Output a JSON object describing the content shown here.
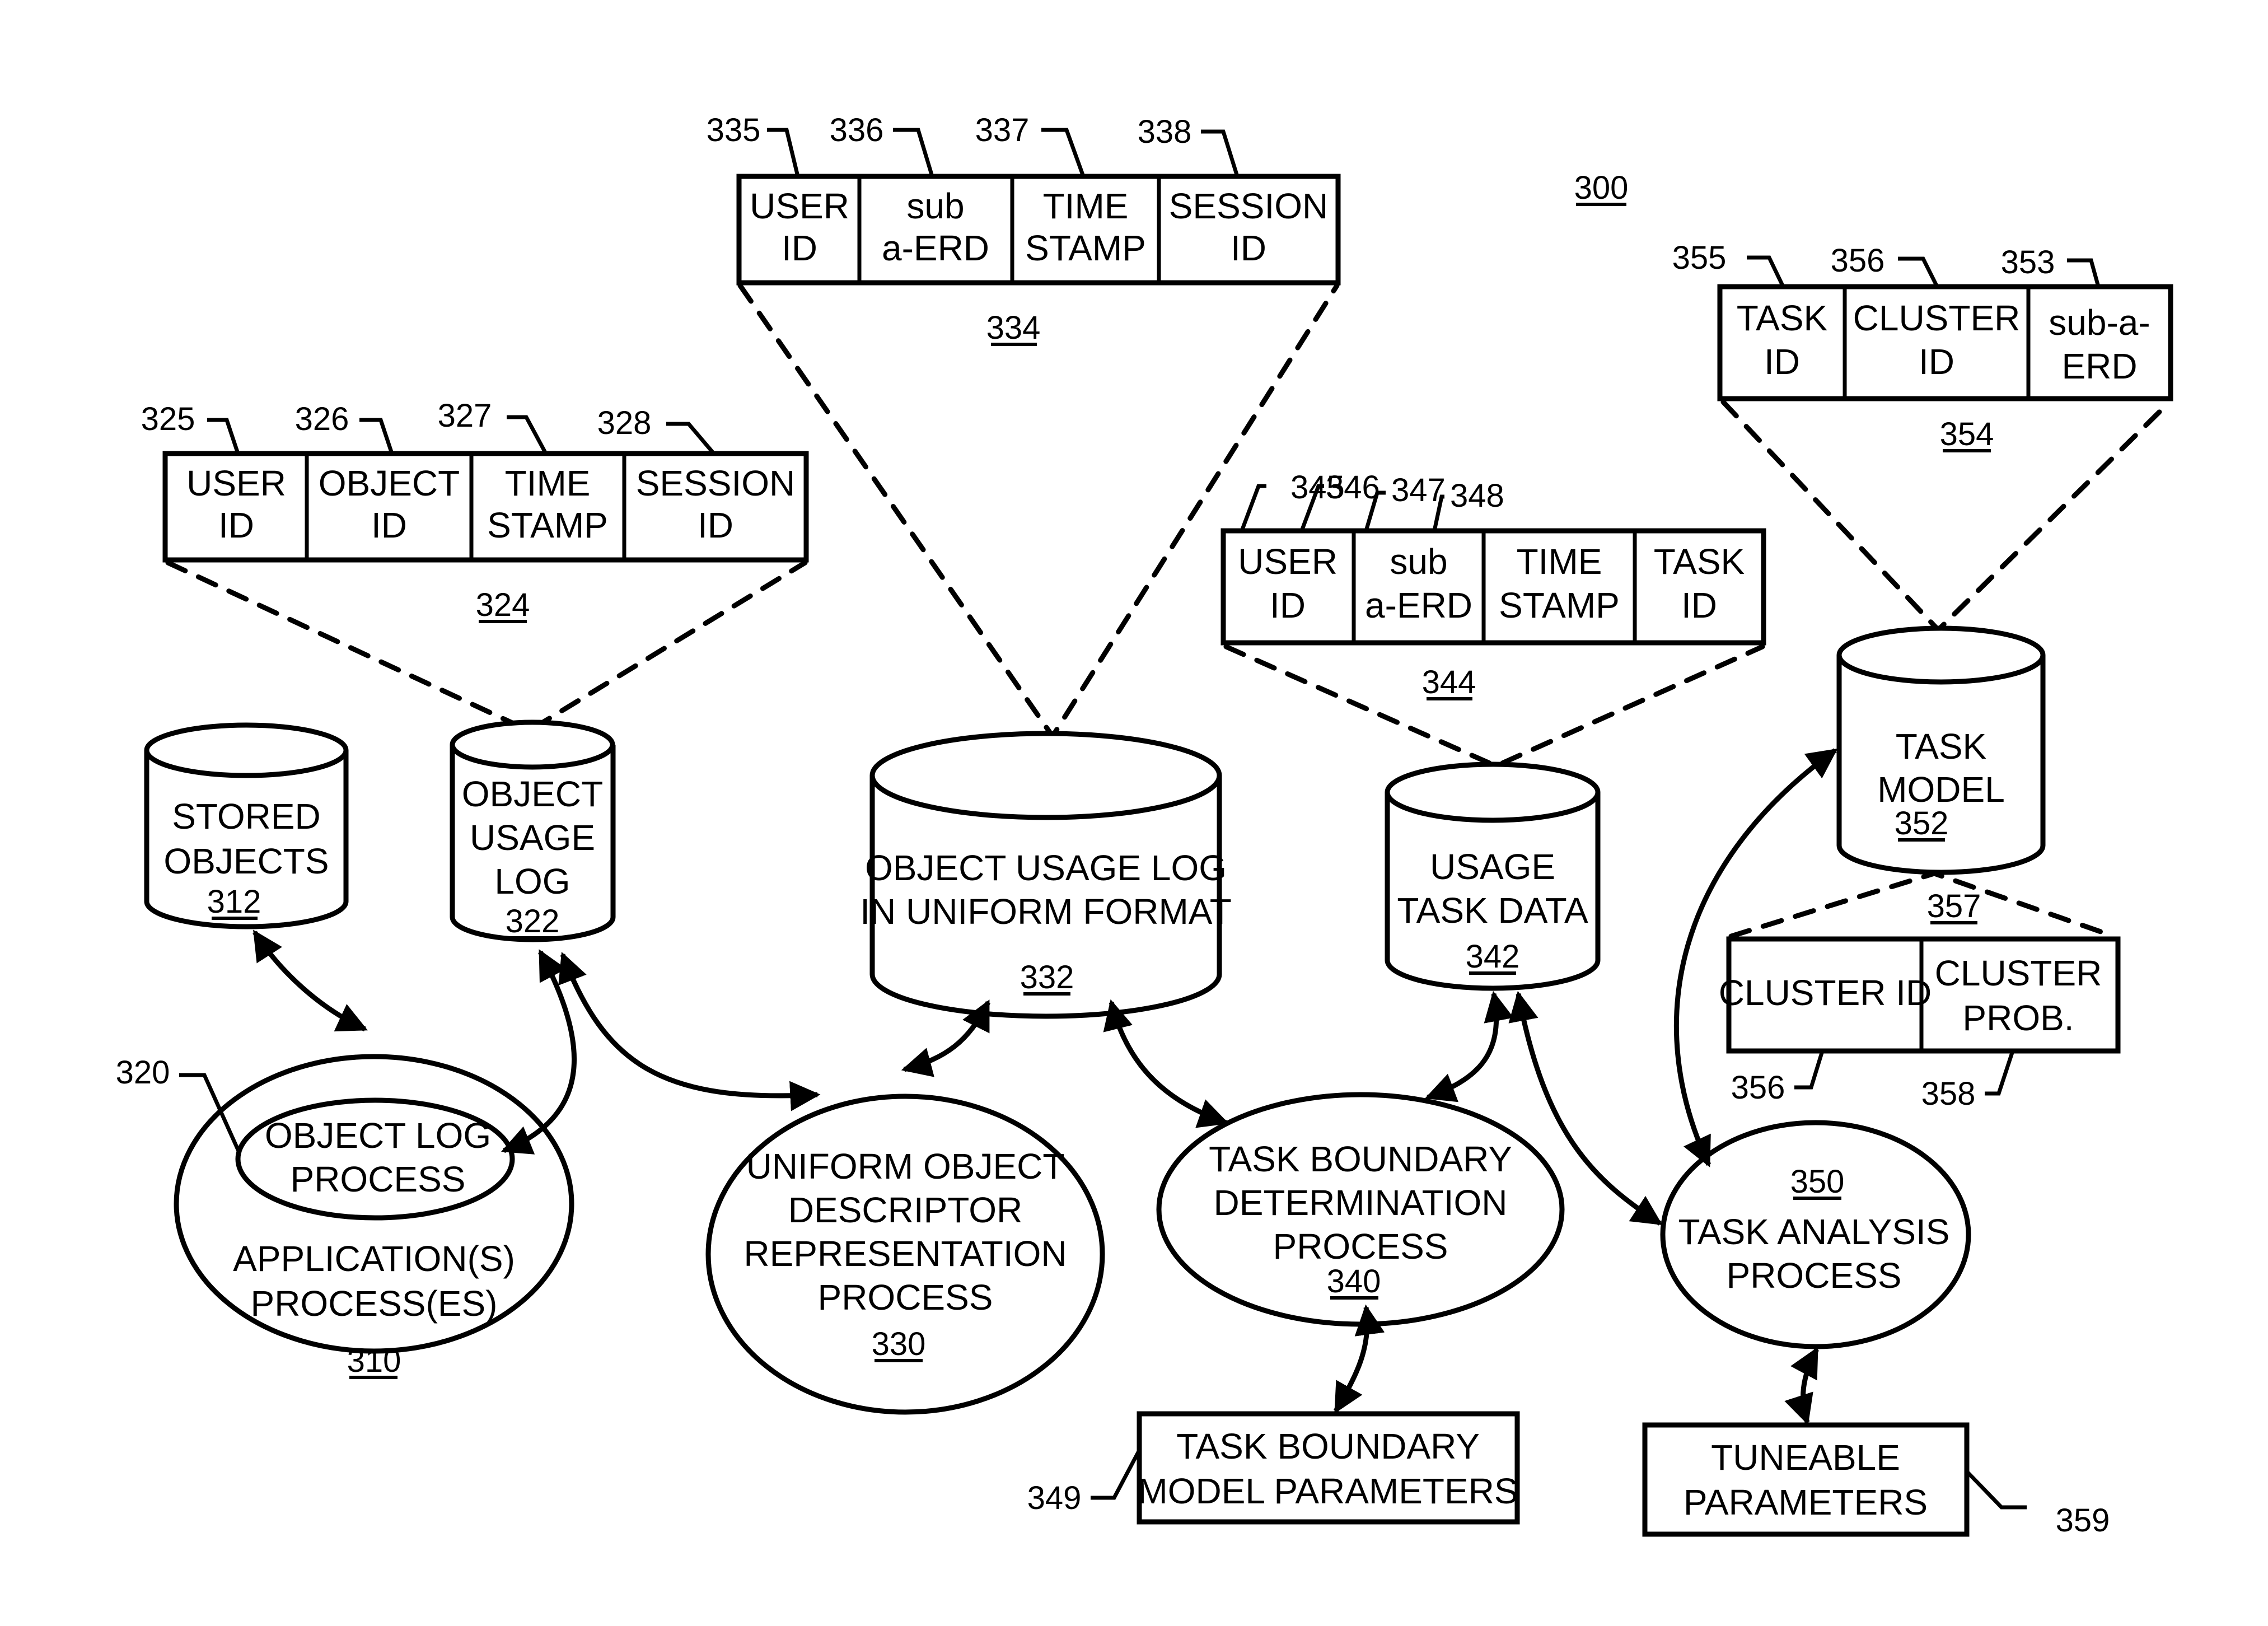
{
  "figure": {
    "number": "300",
    "colors": {
      "ink": "#000000",
      "paper": "#ffffff"
    }
  },
  "records": {
    "r324": {
      "ref": "324",
      "fields": [
        {
          "ref": "325",
          "lines": [
            "USER",
            "ID"
          ]
        },
        {
          "ref": "326",
          "lines": [
            "OBJECT",
            "ID"
          ]
        },
        {
          "ref": "327",
          "lines": [
            "TIME",
            "STAMP"
          ]
        },
        {
          "ref": "328",
          "lines": [
            "SESSION",
            "ID"
          ]
        }
      ]
    },
    "r334": {
      "ref": "334",
      "fields": [
        {
          "ref": "335",
          "lines": [
            "USER",
            "ID"
          ]
        },
        {
          "ref": "336",
          "lines": [
            "sub",
            "a-ERD"
          ]
        },
        {
          "ref": "337",
          "lines": [
            "TIME",
            "STAMP"
          ]
        },
        {
          "ref": "338",
          "lines": [
            "SESSION",
            "ID"
          ]
        }
      ]
    },
    "r344": {
      "ref": "344",
      "fields": [
        {
          "ref": "345",
          "lines": [
            "USER",
            "ID"
          ]
        },
        {
          "ref": "346",
          "lines": [
            "sub",
            "a-ERD"
          ]
        },
        {
          "ref": "347",
          "lines": [
            "TIME",
            "STAMP"
          ]
        },
        {
          "ref": "348",
          "lines": [
            "TASK",
            "ID"
          ]
        }
      ]
    },
    "r354": {
      "ref": "354",
      "fields": [
        {
          "ref": "355",
          "lines": [
            "TASK",
            "ID"
          ]
        },
        {
          "ref": "356",
          "lines": [
            "CLUSTER",
            "ID"
          ]
        },
        {
          "ref": "353",
          "lines": [
            "sub-a-",
            "ERD"
          ]
        }
      ]
    },
    "r357": {
      "ref": "357",
      "fields": [
        {
          "ref": "356",
          "lines": [
            "CLUSTER ID"
          ]
        },
        {
          "ref": "358",
          "lines": [
            "CLUSTER",
            "PROB."
          ]
        }
      ]
    }
  },
  "stores": {
    "s312": {
      "ref": "312",
      "lines": [
        "STORED",
        "OBJECTS"
      ]
    },
    "s322": {
      "ref": "322",
      "lines": [
        "OBJECT",
        "USAGE",
        "LOG"
      ]
    },
    "s332": {
      "ref": "332",
      "lines": [
        "OBJECT USAGE LOG",
        "IN UNIFORM FORMAT"
      ]
    },
    "s342": {
      "ref": "342",
      "lines": [
        "USAGE",
        "TASK DATA"
      ]
    },
    "s352": {
      "ref": "352",
      "lines": [
        "TASK",
        "MODEL"
      ]
    }
  },
  "processes": {
    "p310": {
      "ref": "310",
      "lines": [
        "APPLICATION(S)",
        "PROCESS(ES)"
      ]
    },
    "p320": {
      "ref": "320",
      "lines": [
        "OBJECT LOG",
        "PROCESS"
      ]
    },
    "p330": {
      "ref": "330",
      "lines": [
        "UNIFORM OBJECT",
        "DESCRIPTOR",
        "REPRESENTATION",
        "PROCESS"
      ]
    },
    "p340": {
      "ref": "340",
      "lines": [
        "TASK BOUNDARY",
        "DETERMINATION",
        "PROCESS"
      ]
    },
    "p350": {
      "ref": "350",
      "lines": [
        "TASK ANALYSIS",
        "PROCESS"
      ]
    }
  },
  "parameters": {
    "b349": {
      "ref": "349",
      "lines": [
        "TASK BOUNDARY",
        "MODEL PARAMETERS"
      ]
    },
    "b359": {
      "ref": "359",
      "lines": [
        "TUNEABLE",
        "PARAMETERS"
      ]
    }
  }
}
